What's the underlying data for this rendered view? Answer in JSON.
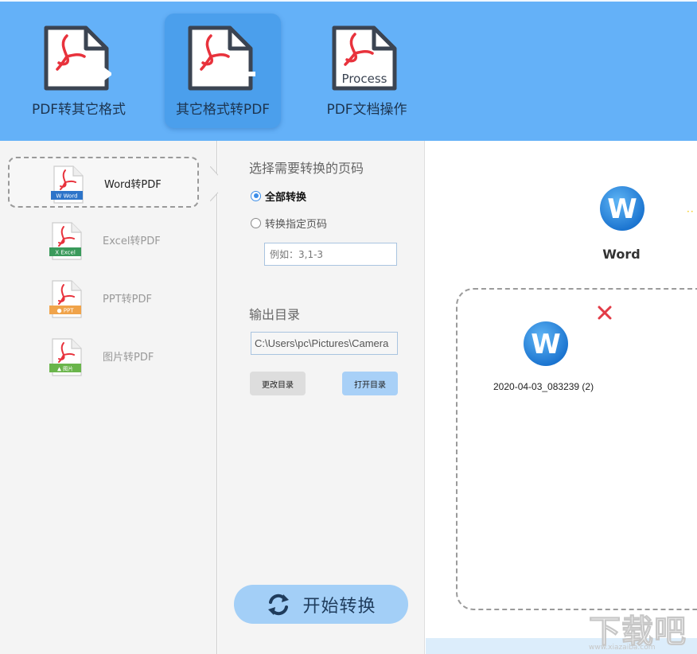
{
  "colors": {
    "toolbar_bg": "#64b1f8",
    "toolbar_active": "#4b9fec",
    "panel_bg": "#f4f4f4",
    "accent": "#3d8ee8",
    "pdf_red": "#e8323c",
    "icon_dark": "#3b4452",
    "start_button": "#a3cff7",
    "close_red": "#e23b46"
  },
  "toolbar": {
    "tabs": [
      {
        "label": "PDF转其它格式",
        "icon": "pdf-export-icon",
        "active": false
      },
      {
        "label": "其它格式转PDF",
        "icon": "pdf-import-icon",
        "active": true
      },
      {
        "label": "PDF文档操作",
        "icon": "pdf-process-icon",
        "active": false,
        "icon_text": "Process"
      }
    ]
  },
  "formats": [
    {
      "label": "Word转PDF",
      "badge": "W Word",
      "badge_color": "#2d74c9",
      "selected": true
    },
    {
      "label": "Excel转PDF",
      "badge": "X Excel",
      "badge_color": "#3a9a5b",
      "selected": false
    },
    {
      "label": "PPT转PDF",
      "badge": "● PPT",
      "badge_color": "#f0a34a",
      "selected": false
    },
    {
      "label": "图片转PDF",
      "badge": "▲ 图片",
      "badge_color": "#6ab54b",
      "selected": false
    }
  ],
  "settings": {
    "page_section_title": "选择需要转换的页码",
    "radio_all": "全部转换",
    "radio_all_checked": true,
    "radio_specific": "转换指定页码",
    "page_placeholder": "例如：3,1-3",
    "output_section_title": "输出目录",
    "output_dir": "C:\\Users\\pc\\Pictures\\Camera",
    "change_dir_label": "更改目录",
    "open_dir_label": "打开目录",
    "start_label": "开始转换"
  },
  "preview": {
    "target_label": "Word",
    "target_icon": "word-icon",
    "badge_letter": "W",
    "dots": "··",
    "files": [
      {
        "name": "2020-04-03_083239 (2)",
        "icon": "word-icon"
      }
    ]
  },
  "watermark": {
    "text": "下载吧",
    "url": "www.xiazaiba.com"
  }
}
